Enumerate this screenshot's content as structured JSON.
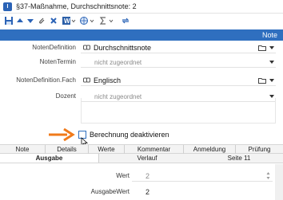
{
  "window": {
    "title": "§37-Maßnahme, Durchschnittsnote: 2"
  },
  "toolbar": {
    "items": [
      "save-icon",
      "arrow-up-icon",
      "arrow-down-icon",
      "attach-icon",
      "close-icon",
      "word-icon",
      "globe-icon",
      "sum-icon",
      "refresh-icon"
    ]
  },
  "header": {
    "label": "Note"
  },
  "form": {
    "fields": [
      {
        "label": "NotenDefinition",
        "value": "Durchschnittsnote"
      },
      {
        "label": "NotenTermin",
        "value": "nicht zugeordnet"
      },
      {
        "label": "NotenDefinition.Fach",
        "value": "Englisch"
      },
      {
        "label": "Dozent",
        "value": "nicht zugeordnet"
      }
    ],
    "checkbox_label": "Berechnung deaktivieren"
  },
  "tabs": [
    "Note",
    "Details",
    "Werte",
    "Kommentar",
    "Anmeldung",
    "Prüfung"
  ],
  "subtabs": [
    "Ausgabe",
    "Verlauf",
    "Seite 11"
  ],
  "detail": {
    "wert_label": "Wert",
    "wert_value": "2",
    "ausgabewert_label": "AusgabeWert",
    "ausgabewert_value": "2"
  },
  "colors": {
    "accent": "#2f6fbf",
    "arrow": "#f07a1a"
  }
}
